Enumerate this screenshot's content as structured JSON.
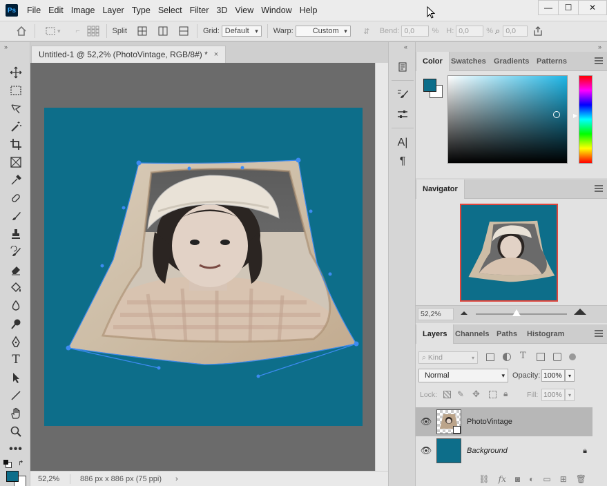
{
  "app": {
    "logo": "Ps"
  },
  "menu": [
    "File",
    "Edit",
    "Image",
    "Layer",
    "Type",
    "Select",
    "Filter",
    "3D",
    "View",
    "Window",
    "Help"
  ],
  "window_controls": {
    "minimize": "—",
    "maximize": "☐",
    "close": "✕"
  },
  "options": {
    "split_label": "Split",
    "grid_label": "Grid:",
    "grid_value": "Default",
    "warp_label": "Warp:",
    "warp_value": "Custom",
    "bend_label": "Bend:",
    "bend_value": "0,0",
    "bend_unit": "%",
    "h_label": "H:",
    "h_value": "0,0",
    "h_unit": "%",
    "v_value": "0,0"
  },
  "document": {
    "tab_title": "Untitled-1 @ 52,2% (PhotoVintage, RGB/8#) *",
    "tab_close": "×",
    "zoom": "52,2%",
    "doc_info": "886 px x 886 px (75 ppi)",
    "status_arrow": "›",
    "canvas_color": "#0d6e8a"
  },
  "color_panel": {
    "tabs": [
      "Color",
      "Swatches",
      "Gradients",
      "Patterns"
    ],
    "fg": "#0d6e8a",
    "bg": "#ffffff"
  },
  "navigator": {
    "title": "Navigator",
    "zoom": "52,2%"
  },
  "layers_panel": {
    "tabs": [
      "Layers",
      "Channels",
      "Paths",
      "Histogram"
    ],
    "kind_label": "Kind",
    "blend_mode": "Normal",
    "opacity_label": "Opacity:",
    "opacity_value": "100%",
    "lock_label": "Lock:",
    "fill_label": "Fill:",
    "fill_value": "100%",
    "layers": [
      {
        "name": "PhotoVintage",
        "selected": true,
        "visible": true
      },
      {
        "name": "Background",
        "selected": false,
        "visible": true,
        "locked": true
      }
    ]
  },
  "icons": {
    "eye": "eye-icon",
    "lock": "lock-icon"
  }
}
